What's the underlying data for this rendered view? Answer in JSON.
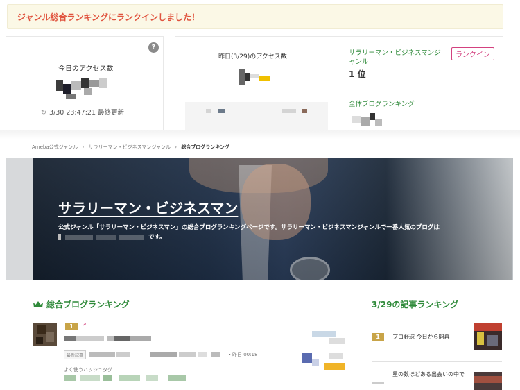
{
  "notice": {
    "text": "ジャンル総合ランキングにランクインしました！"
  },
  "access_today": {
    "label": "今日のアクセス数",
    "help_icon": "question-circle-icon",
    "updated": "3/30 23:47:21 最終更新"
  },
  "access_yesterday": {
    "label": "昨日(3/29)のアクセス数",
    "genre": "サラリーマン・ビジネスマンジャンル",
    "rank_badge": "ランクイン",
    "rank": "1 位",
    "overall_label": "全体ブログランキング"
  },
  "breadcrumb": {
    "items": [
      "Ameba公式ジャンル",
      "›",
      "サラリーマン・ビジネスマンジャンル",
      "›"
    ],
    "current": "総合ブログランキング"
  },
  "hero": {
    "title": "サラリーマン・ビジネスマン",
    "desc_line1": "公式ジャンル「サラリーマン・ビジネスマン」の総合ブログランキングページです。サラリーマン・ビジネスマンジャンルで一番人気のブログは",
    "desc_line2_end": "です。"
  },
  "overall_ranking": {
    "title": "総合ブログランキング",
    "crown_icon": "crown-icon",
    "rank": "1",
    "latest_tag": "最新記事",
    "time": "・昨日 00:18",
    "hashtag_label": "よく使うハッシュタグ"
  },
  "article_ranking": {
    "title": "3/29の記事ランキング",
    "items": [
      {
        "rank": "1",
        "text": "プロ野球 今日から開幕"
      },
      {
        "rank": "2",
        "text": "星の数ほどある出会いの中で"
      }
    ]
  },
  "colors": {
    "accent_green": "#2f8a3a",
    "notice_red": "#e0533e",
    "rankin_pink": "#d3417f",
    "gold": "#c8a448"
  }
}
